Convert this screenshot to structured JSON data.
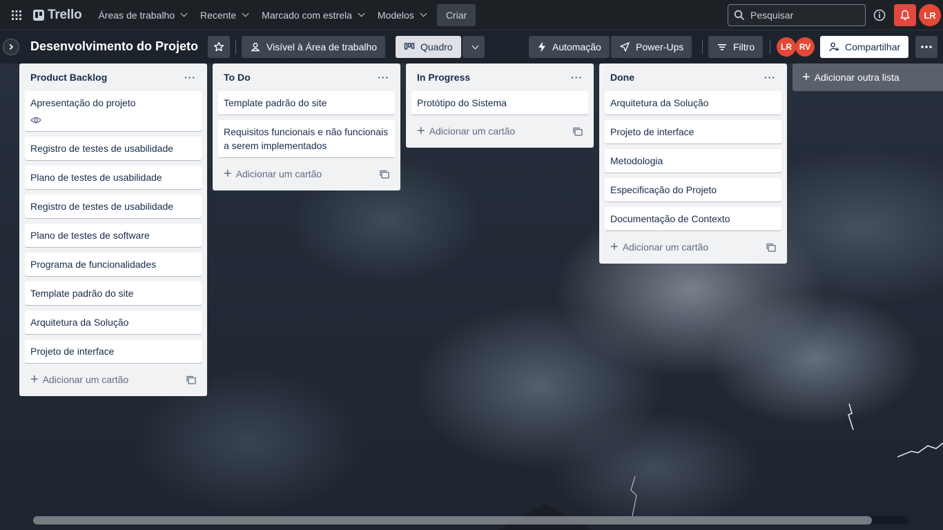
{
  "nav": {
    "app_name": "Trello",
    "menu": [
      {
        "label": "Áreas de trabalho"
      },
      {
        "label": "Recente"
      },
      {
        "label": "Marcado com estrela"
      },
      {
        "label": "Modelos"
      }
    ],
    "create_label": "Criar",
    "search_placeholder": "Pesquisar",
    "user_initials": "LR"
  },
  "board": {
    "title": "Desenvolvimento do Projeto",
    "visibility_label": "Visível à Área de trabalho",
    "view_label": "Quadro",
    "automation_label": "Automação",
    "powerups_label": "Power-Ups",
    "filter_label": "Filtro",
    "members": [
      "LR",
      "RV"
    ],
    "share_label": "Compartilhar",
    "add_list_label": "Adicionar outra lista"
  },
  "add_card_label": "Adicionar um cartão",
  "lists": [
    {
      "title": "Product Backlog",
      "cards": [
        "Apresentação do projeto",
        "Registro de testes de usabilidade",
        "Plano de testes de usabilidade",
        "Registro de testes de usabilidade",
        "Plano de testes de software",
        "Programa de funcionalidades",
        "Template padrão do site",
        "Arquitetura da Solução",
        "Projeto de interface"
      ]
    },
    {
      "title": "To Do",
      "cards": [
        "Template padrão do site",
        "Requisitos funcionais e não funcionais a serem implementados"
      ]
    },
    {
      "title": "In Progress",
      "cards": [
        "Protótipo do Sistema"
      ]
    },
    {
      "title": "Done",
      "cards": [
        "Arquitetura da Solução",
        "Projeto de interface",
        "Metodologia",
        "Especificação do Projeto",
        "Documentação de Contexto"
      ]
    }
  ],
  "colors": {
    "nav_bg": "#1d2125",
    "list_bg": "#f1f2f4",
    "notification": "#e2483d",
    "avatar": "#e34935"
  }
}
